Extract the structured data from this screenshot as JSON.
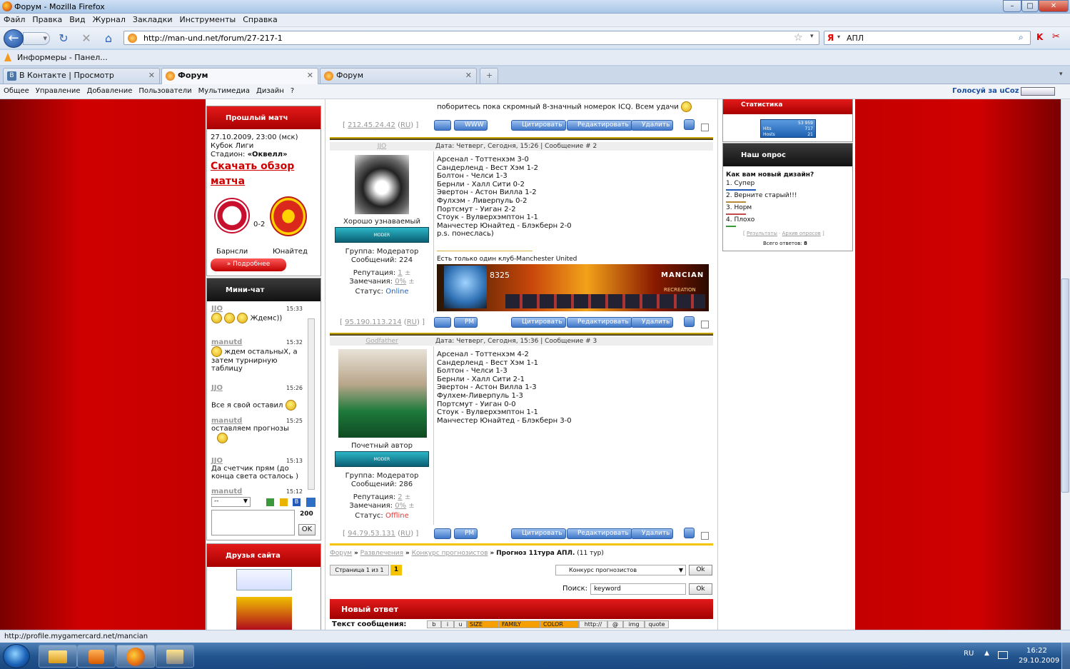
{
  "window": {
    "title": "Форум - Mozilla Firefox"
  },
  "menu": [
    "Файл",
    "Правка",
    "Вид",
    "Журнал",
    "Закладки",
    "Инструменты",
    "Справка"
  ],
  "nav": {
    "url": "http://man-und.net/forum/27-217-1",
    "search_value": "АПЛ"
  },
  "bookmarks": [
    "Информеры - Панел..."
  ],
  "tabs": [
    {
      "label": "В Контакте | Просмотр сообщения"
    },
    {
      "label": "Форум",
      "active": true
    },
    {
      "label": "Форум"
    }
  ],
  "ucoz": {
    "items": [
      "Общее",
      "Управление",
      "Добавление",
      "Пользователи",
      "Мультимедиа",
      "Дизайн",
      "?"
    ],
    "vote": "Голосуй за uCoz"
  },
  "last_match": {
    "header": "Прошлый матч",
    "datetime": "27.10.2009, 23:00 (мск)",
    "competition": "Кубок Лиги",
    "stadium_label": "Стадион:",
    "stadium": "«Оквелл»",
    "download": "Скачать обзор матча",
    "score": "0-2",
    "home": "Барнсли",
    "away": "Юнайтед",
    "more": "» Подробнее"
  },
  "minichat": {
    "header": "Мини-чат",
    "messages": [
      {
        "user": "JJO",
        "time": "15:33",
        "text": "Ждемс))"
      },
      {
        "user": "manutd",
        "time": "15:32",
        "text": "ждем остальныХ, а затем турнирную таблицу"
      },
      {
        "user": "JJO",
        "time": "15:26",
        "text": "Все я свой оставил"
      },
      {
        "user": "manutd",
        "time": "15:25",
        "text": "оставляем прогнозы"
      },
      {
        "user": "JJO",
        "time": "15:13",
        "text": "Да счетчик прям (до конца света осталось )"
      },
      {
        "user": "manutd",
        "time": "15:12",
        "text": ""
      }
    ],
    "select": "--",
    "counter": "200",
    "ok": "OK"
  },
  "friends": {
    "header": "Друзья сайта"
  },
  "posts": [
    {
      "text_tail": "поборитесь пока скромный 8-значный номерок ICQ. Всем удачи",
      "ip": "212.45.24.42",
      "ip_country": "RU"
    },
    {
      "author": "JJO",
      "header": "Дата: Четверг, Сегодня, 15:26 | Сообщение # 2",
      "title": "Хорошо узнаваемый",
      "rank": "MODER",
      "group": "Группа: Модератор",
      "messages": "Сообщений: 224",
      "reputation_label": "Репутация:",
      "reputation": "1",
      "warnings_label": "Замечания:",
      "warnings": "0%",
      "status_label": "Статус:",
      "status": "Online",
      "lines": [
        "Арсенал - Тоттенхэм 3-0",
        "Сандерленд - Вест Хэм 1-2",
        "Болтон - Челси 1-3",
        "Бернли - Халл Сити 0-2",
        "Эвертон - Астон Вилла 1-2",
        "Фулхэм - Ливерпуль 0-2",
        "Портсмут - Уиган 2-2",
        "Стоук - Вулверхэмптон 1-1",
        "Манчестер Юнайтед - Блэкберн 2-0",
        "p.s. понеслась)"
      ],
      "signature": "Есть только один клуб-Manchester United",
      "gamercard_score": "8325",
      "gamercard_name": "MANCIAN",
      "gamercard_sub": "RECREATION",
      "ip": "95.190.113.214",
      "ip_country": "RU"
    },
    {
      "author": "Godfather",
      "header": "Дата: Четверг, Сегодня, 15:36 | Сообщение # 3",
      "title": "Почетный автор",
      "rank": "MODER",
      "group": "Группа: Модератор",
      "messages": "Сообщений: 286",
      "reputation_label": "Репутация:",
      "reputation": "2",
      "warnings_label": "Замечания:",
      "warnings": "0%",
      "status_label": "Статус:",
      "status": "Offline",
      "lines": [
        "Арсенал - Тоттенхэм 4-2",
        "Сандерленд - Вест Хэм 1-1",
        "Болтон - Челси 1-3",
        "Бернли - Халл Сити 2-1",
        "Эвертон - Астон Вилла 1-3",
        "Фулхем-Ливерпуль 1-3",
        "Портсмут - Уиган 0-0",
        "Стоук - Вулверхэмптон 1-1",
        "Манчестер Юнайтед - Блэкберн 3-0"
      ],
      "ip": "94.79.53.131",
      "ip_country": "RU"
    }
  ],
  "post_buttons": {
    "www": "WWW",
    "pm": "PM",
    "quote": "Цитировать",
    "edit": "Редактировать",
    "delete": "Удалить"
  },
  "breadcrumb": {
    "forum": "Форум",
    "sep": "»",
    "section": "Развлечения",
    "sub": "Конкурс прогнозистов",
    "current": "Прогноз 11тура АПЛ.",
    "suffix": "(11 тур)"
  },
  "pager": {
    "label": "Страница 1 из 1",
    "current": "1",
    "jump": "Конкурс прогнозистов",
    "ok": "Ok"
  },
  "search": {
    "label": "Поиск:",
    "value": "keyword",
    "ok": "Ok"
  },
  "reply": {
    "header": "Новый ответ",
    "text_label": "Текст сообщения:",
    "bbcodes": [
      "b",
      "i",
      "u",
      "SIZE",
      "FAMILY",
      "COLOR",
      "http://",
      "@",
      "img",
      "quote"
    ]
  },
  "stats": {
    "header": "Статистика",
    "counter": "53 959",
    "hits_label": "Hits",
    "hits": "717",
    "hosts_label": "Hosts",
    "hosts": "21"
  },
  "poll": {
    "header": "Наш опрос",
    "question": "Как вам новый дизайн?",
    "options": [
      "1. Супер",
      "2. Верните старый!!!",
      "3. Норм",
      "4. Плохо"
    ],
    "results": "Результаты",
    "archive": "Архив опросов",
    "total_label": "Всего ответов:",
    "total": "8"
  },
  "statusbar": {
    "text": "http://profile.mygamercard.net/mancian"
  },
  "tray": {
    "lang": "RU",
    "time": "16:22",
    "date": "29.10.2009"
  }
}
